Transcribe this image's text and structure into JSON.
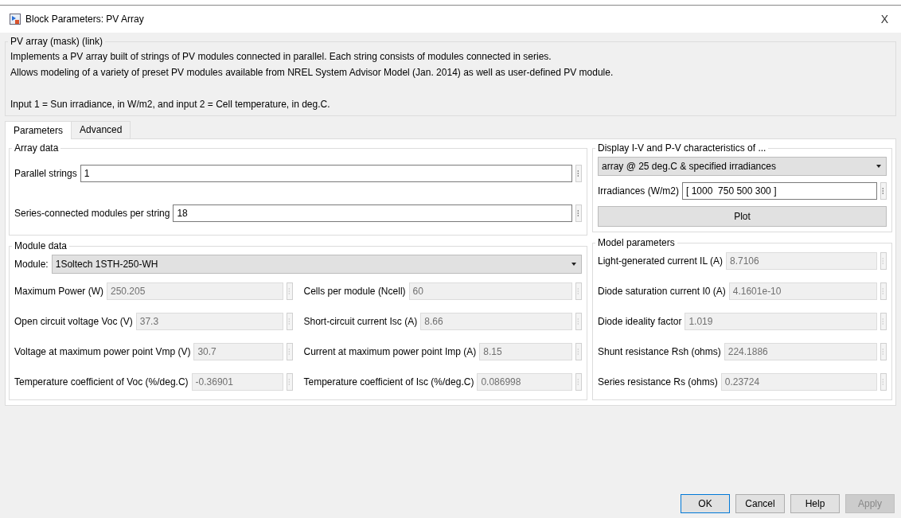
{
  "window": {
    "title": "Block Parameters: PV Array",
    "close": "X"
  },
  "mask": {
    "title": "PV array (mask) (link)",
    "description": [
      "Implements a PV array built of strings of PV modules connected in parallel. Each string consists of modules connected in series.",
      "Allows modeling of a variety of preset PV modules available from NREL System Advisor Model (Jan. 2014) as well as user-defined PV module."
    ],
    "note": "Input 1 = Sun irradiance, in W/m2, and input 2 = Cell temperature, in deg.C."
  },
  "tabs": [
    {
      "label": "Parameters",
      "selected": true
    },
    {
      "label": "Advanced",
      "selected": false
    }
  ],
  "array_data": {
    "title": "Array data",
    "fields": [
      {
        "label": "Parallel strings",
        "value": "1",
        "disabled": false
      },
      {
        "label": "Series-connected modules per string",
        "value": "18",
        "disabled": false
      }
    ]
  },
  "display": {
    "title": "Display  I-V and P-V characteristics of ...",
    "dropdown": "array @ 25 deg.C & specified irradiances",
    "field": {
      "label": "Irradiances (W/m2)",
      "value": "[ 1000  750 500 300 ]",
      "disabled": false
    },
    "button": "Plot"
  },
  "module_data": {
    "title": "Module data",
    "module_label": "Module:",
    "module_value": "1Soltech 1STH-250-WH",
    "fields": [
      {
        "label": "Maximum Power (W)",
        "value": "250.205",
        "disabled": true
      },
      {
        "label": "Cells per module (Ncell)",
        "value": "60",
        "disabled": true
      },
      {
        "label": "Open circuit voltage  Voc (V)",
        "value": "37.3",
        "disabled": true
      },
      {
        "label": "Short-circuit current Isc (A)",
        "value": "8.66",
        "disabled": true
      },
      {
        "label": "Voltage at maximum power point Vmp (V)",
        "value": "30.7",
        "disabled": true
      },
      {
        "label": "Current at maximum power point Imp (A)",
        "value": "8.15",
        "disabled": true
      },
      {
        "label": "Temperature coefficient of Voc (%/deg.C)",
        "value": "-0.36901",
        "disabled": true
      },
      {
        "label": "Temperature coefficient of Isc (%/deg.C)",
        "value": "0.086998",
        "disabled": true
      }
    ]
  },
  "model_parameters": {
    "title": "Model parameters",
    "fields": [
      {
        "label": "Light-generated current IL (A)",
        "value": "8.7106",
        "disabled": true
      },
      {
        "label": "Diode saturation current I0 (A)",
        "value": "4.1601e-10",
        "disabled": true
      },
      {
        "label": "Diode ideality factor",
        "value": "1.019",
        "disabled": true
      },
      {
        "label": "Shunt resistance Rsh (ohms)",
        "value": "224.1886",
        "disabled": true
      },
      {
        "label": "Series resistance Rs (ohms)",
        "value": "0.23724",
        "disabled": true
      }
    ]
  },
  "buttons": [
    {
      "label": "OK",
      "default": true,
      "disabled": false
    },
    {
      "label": "Cancel",
      "default": false,
      "disabled": false
    },
    {
      "label": "Help",
      "default": false,
      "disabled": false
    },
    {
      "label": "Apply",
      "default": false,
      "disabled": true
    }
  ]
}
